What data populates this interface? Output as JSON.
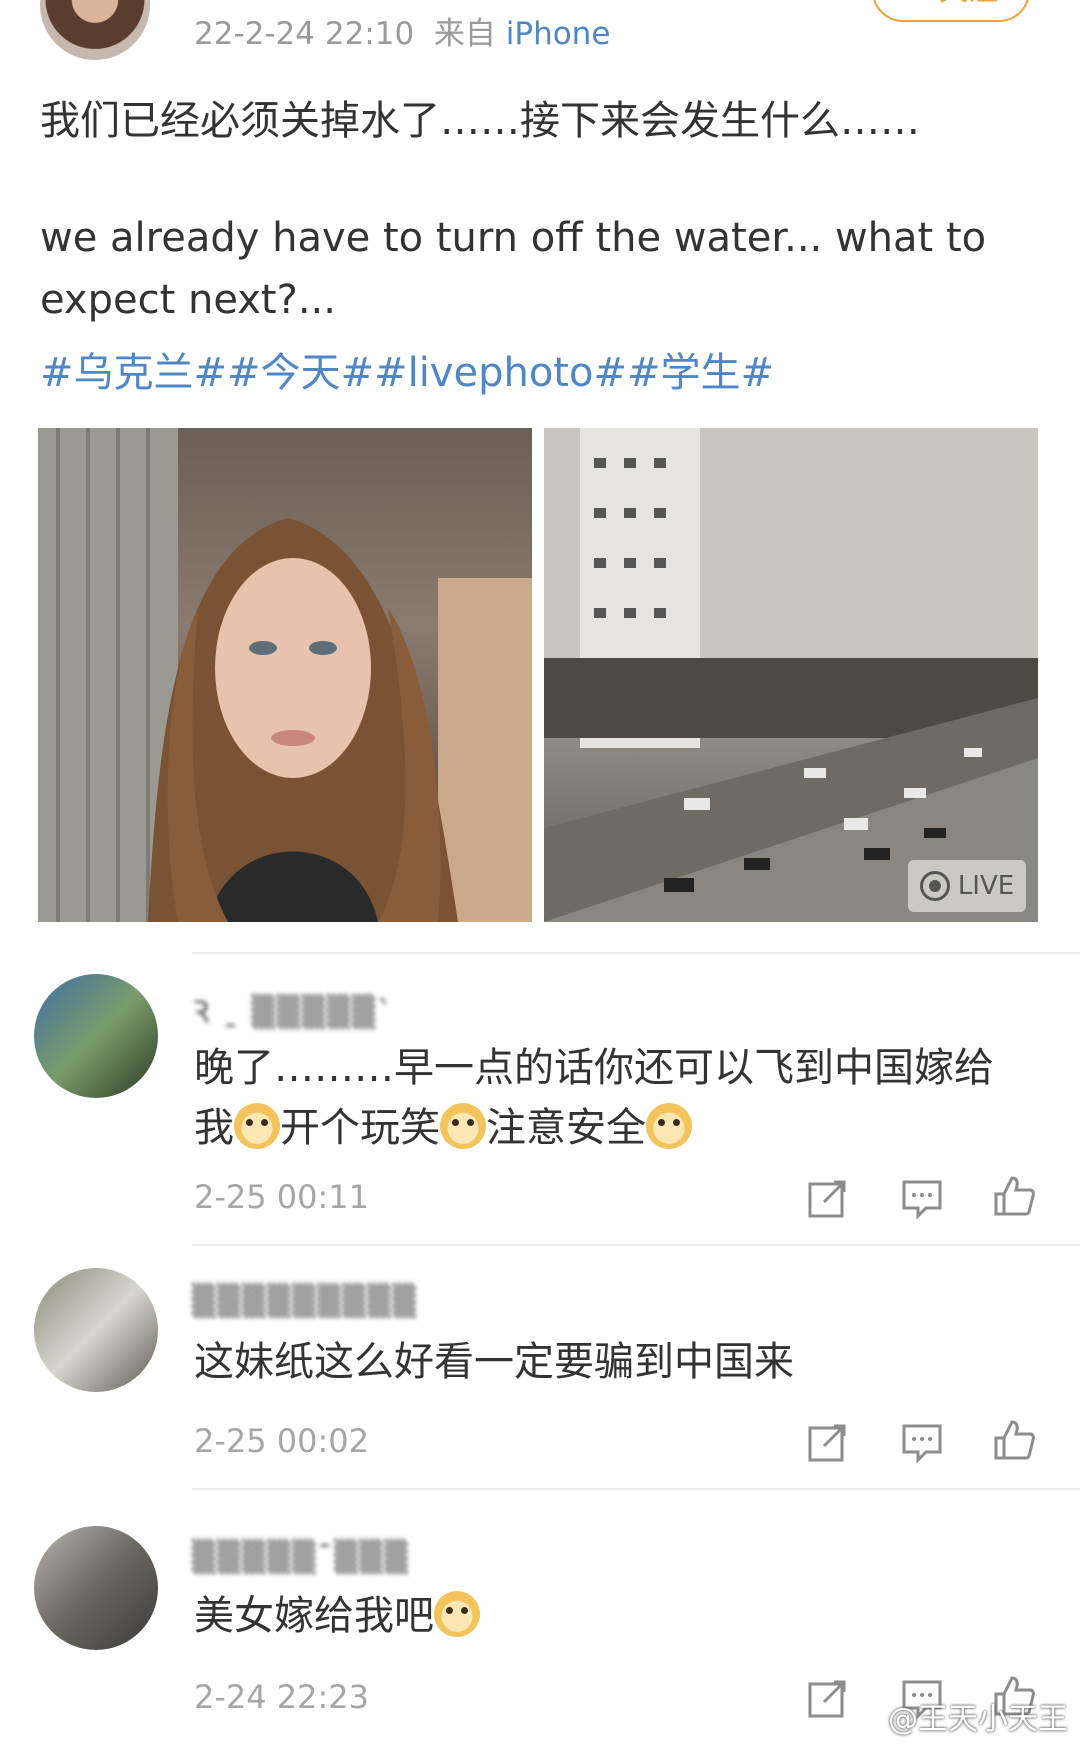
{
  "post": {
    "timestamp": "22-2-24 22:10",
    "source_prefix": "来自",
    "source": "iPhone",
    "follow_label": "+ 关注",
    "text_cn": "我们已经必须关掉水了……接下来会发生什么……",
    "text_en_line1": "we already have to turn off the water... what to",
    "text_en_line2": "expect next?...",
    "tags": "#乌克兰##今天##livephoto##学生#",
    "live_badge": "LIVE"
  },
  "comments": [
    {
      "name": "Ꝛ ˍ ▒▒▒▒▒ˋ",
      "text_part1": "晚了………早一点的话你还可以飞到中国嫁给我",
      "text_part2": "开个玩笑",
      "text_part3": "注意安全",
      "time": "2-25 00:11"
    },
    {
      "name": "▒▒▒▒▒▒▒▒▒",
      "text": "这妹纸这么好看一定要骗到中国来",
      "time": "2-25 00:02"
    },
    {
      "name": "▒▒▒▒▒ˉ▒▒▒",
      "text": "美女嫁给我吧",
      "time": "2-24 22:23"
    }
  ],
  "watermark": "@王天小天王",
  "icons": {
    "share": "share-icon",
    "comment": "comment-icon",
    "like": "thumbs-up-icon",
    "live": "live-photo-icon",
    "emoji": "doge-emoji"
  },
  "colors": {
    "link": "#4f86c6",
    "follow": "#f0a33b",
    "meta": "#9a9a9a"
  }
}
